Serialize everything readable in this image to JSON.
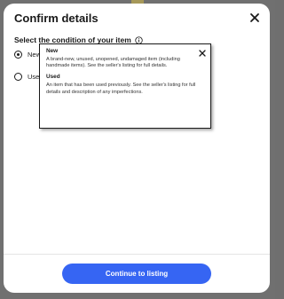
{
  "modal": {
    "title": "Confirm details",
    "close_icon": "close-icon"
  },
  "condition": {
    "label": "Select the condition of your item",
    "info_icon": "info-icon",
    "options": [
      {
        "label": "New",
        "selected": true
      },
      {
        "label": "Used",
        "selected": false
      }
    ]
  },
  "tooltip": {
    "close_icon": "close-icon",
    "sections": [
      {
        "heading": "New",
        "body": "A brand-new, unused, unopened, undamaged item (including handmade items). See the seller's listing for full details."
      },
      {
        "heading": "Used",
        "body": "An item that has been used previously. See the seller's listing for full details and description of any imperfections."
      }
    ]
  },
  "footer": {
    "primary_button": "Continue to listing"
  },
  "colors": {
    "primary": "#3665f3",
    "text": "#191919",
    "overlay": "#707070"
  }
}
